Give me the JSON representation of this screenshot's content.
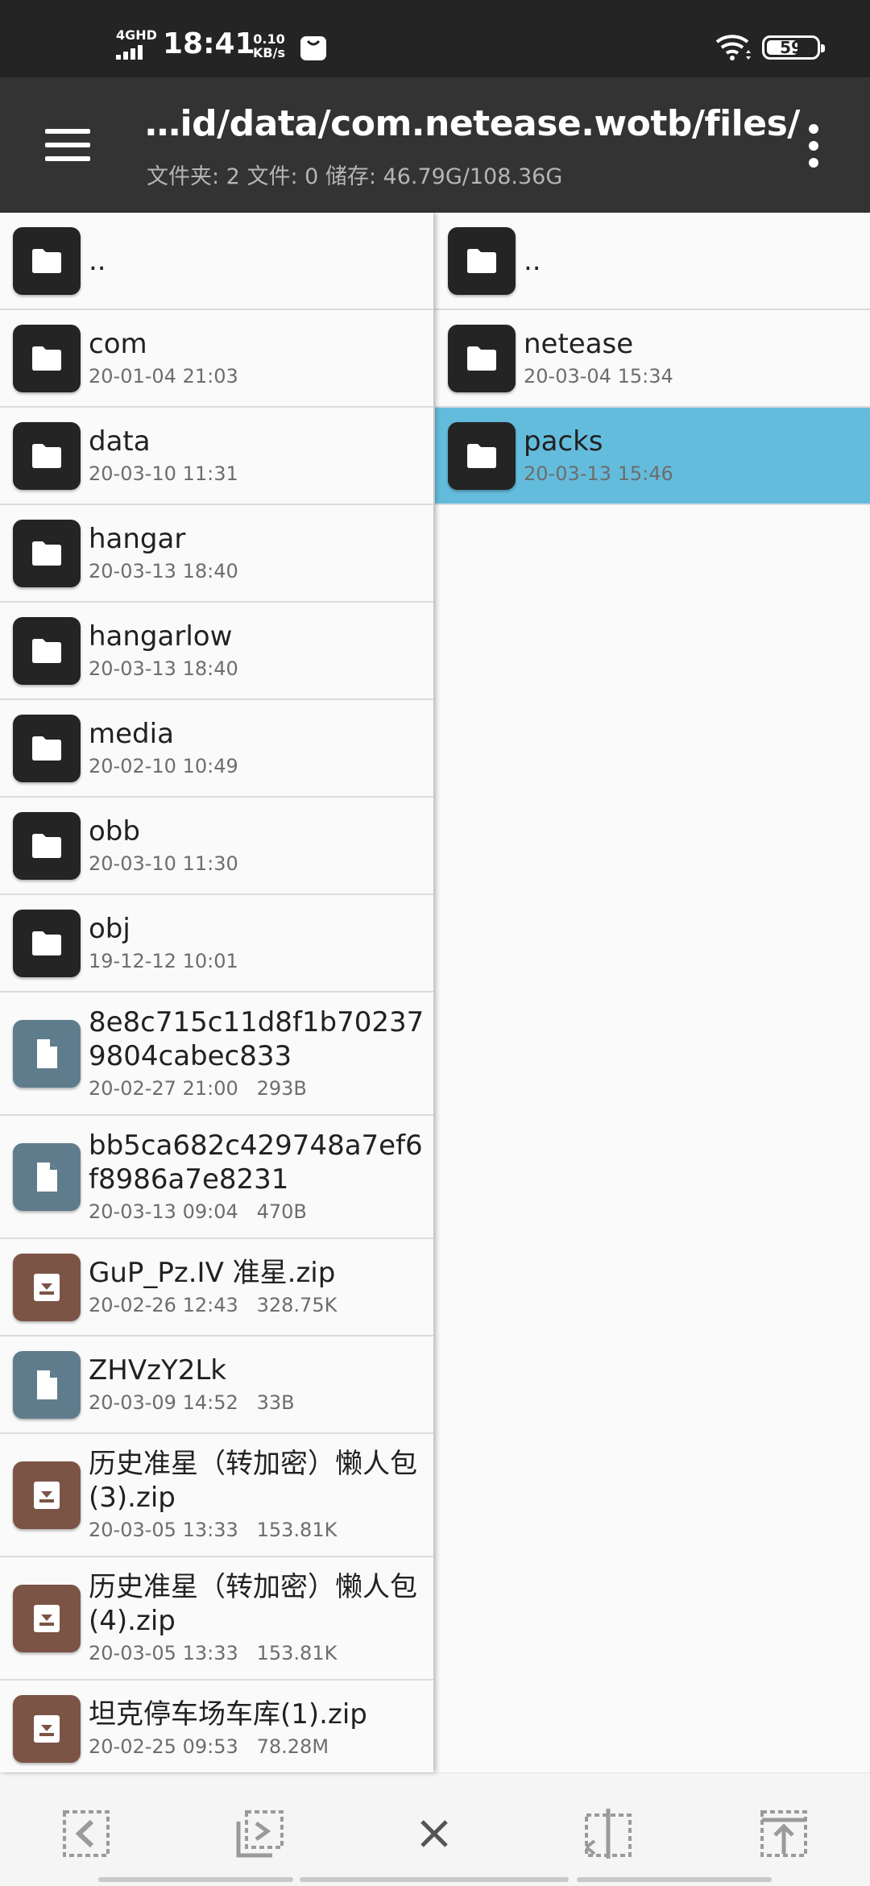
{
  "status_bar": {
    "network": "4GHD",
    "time": "18:41",
    "speed_value": "0.10",
    "speed_unit": "KB/s",
    "battery": "59"
  },
  "header": {
    "path": "…id/data/com.netease.wotb/files/",
    "info": "文件夹: 2  文件: 0  储存: 46.79G/108.36G",
    "menu_icon": "hamburger-menu-icon",
    "more_icon": "more-vert-icon"
  },
  "left_pane": {
    "items": [
      {
        "name": "..",
        "meta": "",
        "type": "folder"
      },
      {
        "name": "com",
        "meta": "20-01-04 21:03",
        "type": "folder"
      },
      {
        "name": "data",
        "meta": "20-03-10 11:31",
        "type": "folder"
      },
      {
        "name": "hangar",
        "meta": "20-03-13 18:40",
        "type": "folder"
      },
      {
        "name": "hangarlow",
        "meta": "20-03-13 18:40",
        "type": "folder"
      },
      {
        "name": "media",
        "meta": "20-02-10 10:49",
        "type": "folder"
      },
      {
        "name": "obb",
        "meta": "20-03-10 11:30",
        "type": "folder"
      },
      {
        "name": "obj",
        "meta": "19-12-12 10:01",
        "type": "folder"
      },
      {
        "name": "8e8c715c11d8f1b702379804cabec833",
        "meta": "20-02-27 21:00   293B",
        "type": "file"
      },
      {
        "name": "bb5ca682c429748a7ef6f8986a7e8231",
        "meta": "20-03-13 09:04   470B",
        "type": "file"
      },
      {
        "name": "GuP_Pz.IV 准星.zip",
        "meta": "20-02-26 12:43   328.75K",
        "type": "archive"
      },
      {
        "name": "ZHVzY2Lk",
        "meta": "20-03-09 14:52   33B",
        "type": "file"
      },
      {
        "name": "历史准星（转加密）懒人包(3).zip",
        "meta": "20-03-05 13:33   153.81K",
        "type": "archive"
      },
      {
        "name": "历史准星（转加密）懒人包(4).zip",
        "meta": "20-03-05 13:33   153.81K",
        "type": "archive"
      },
      {
        "name": "坦克停车场车库(1).zip",
        "meta": "20-02-25 09:53   78.28M",
        "type": "archive"
      }
    ]
  },
  "right_pane": {
    "items": [
      {
        "name": "..",
        "meta": "",
        "type": "folder",
        "selected": false
      },
      {
        "name": "netease",
        "meta": "20-03-04 15:34",
        "type": "folder",
        "selected": false
      },
      {
        "name": "packs",
        "meta": "20-03-13 15:46",
        "type": "folder",
        "selected": true
      }
    ],
    "selected_color": "#64bcdc"
  },
  "toolbar": {
    "buttons": [
      "select-left-icon",
      "select-copy-icon",
      "close-icon",
      "split-pane-icon",
      "move-up-icon"
    ]
  },
  "colors": {
    "status_bar_bg": "#242424",
    "app_bar_bg": "#333333",
    "folder_icon_bg": "#242424",
    "file_icon_bg": "#5f7c8c",
    "archive_icon_bg": "#7b5446"
  }
}
